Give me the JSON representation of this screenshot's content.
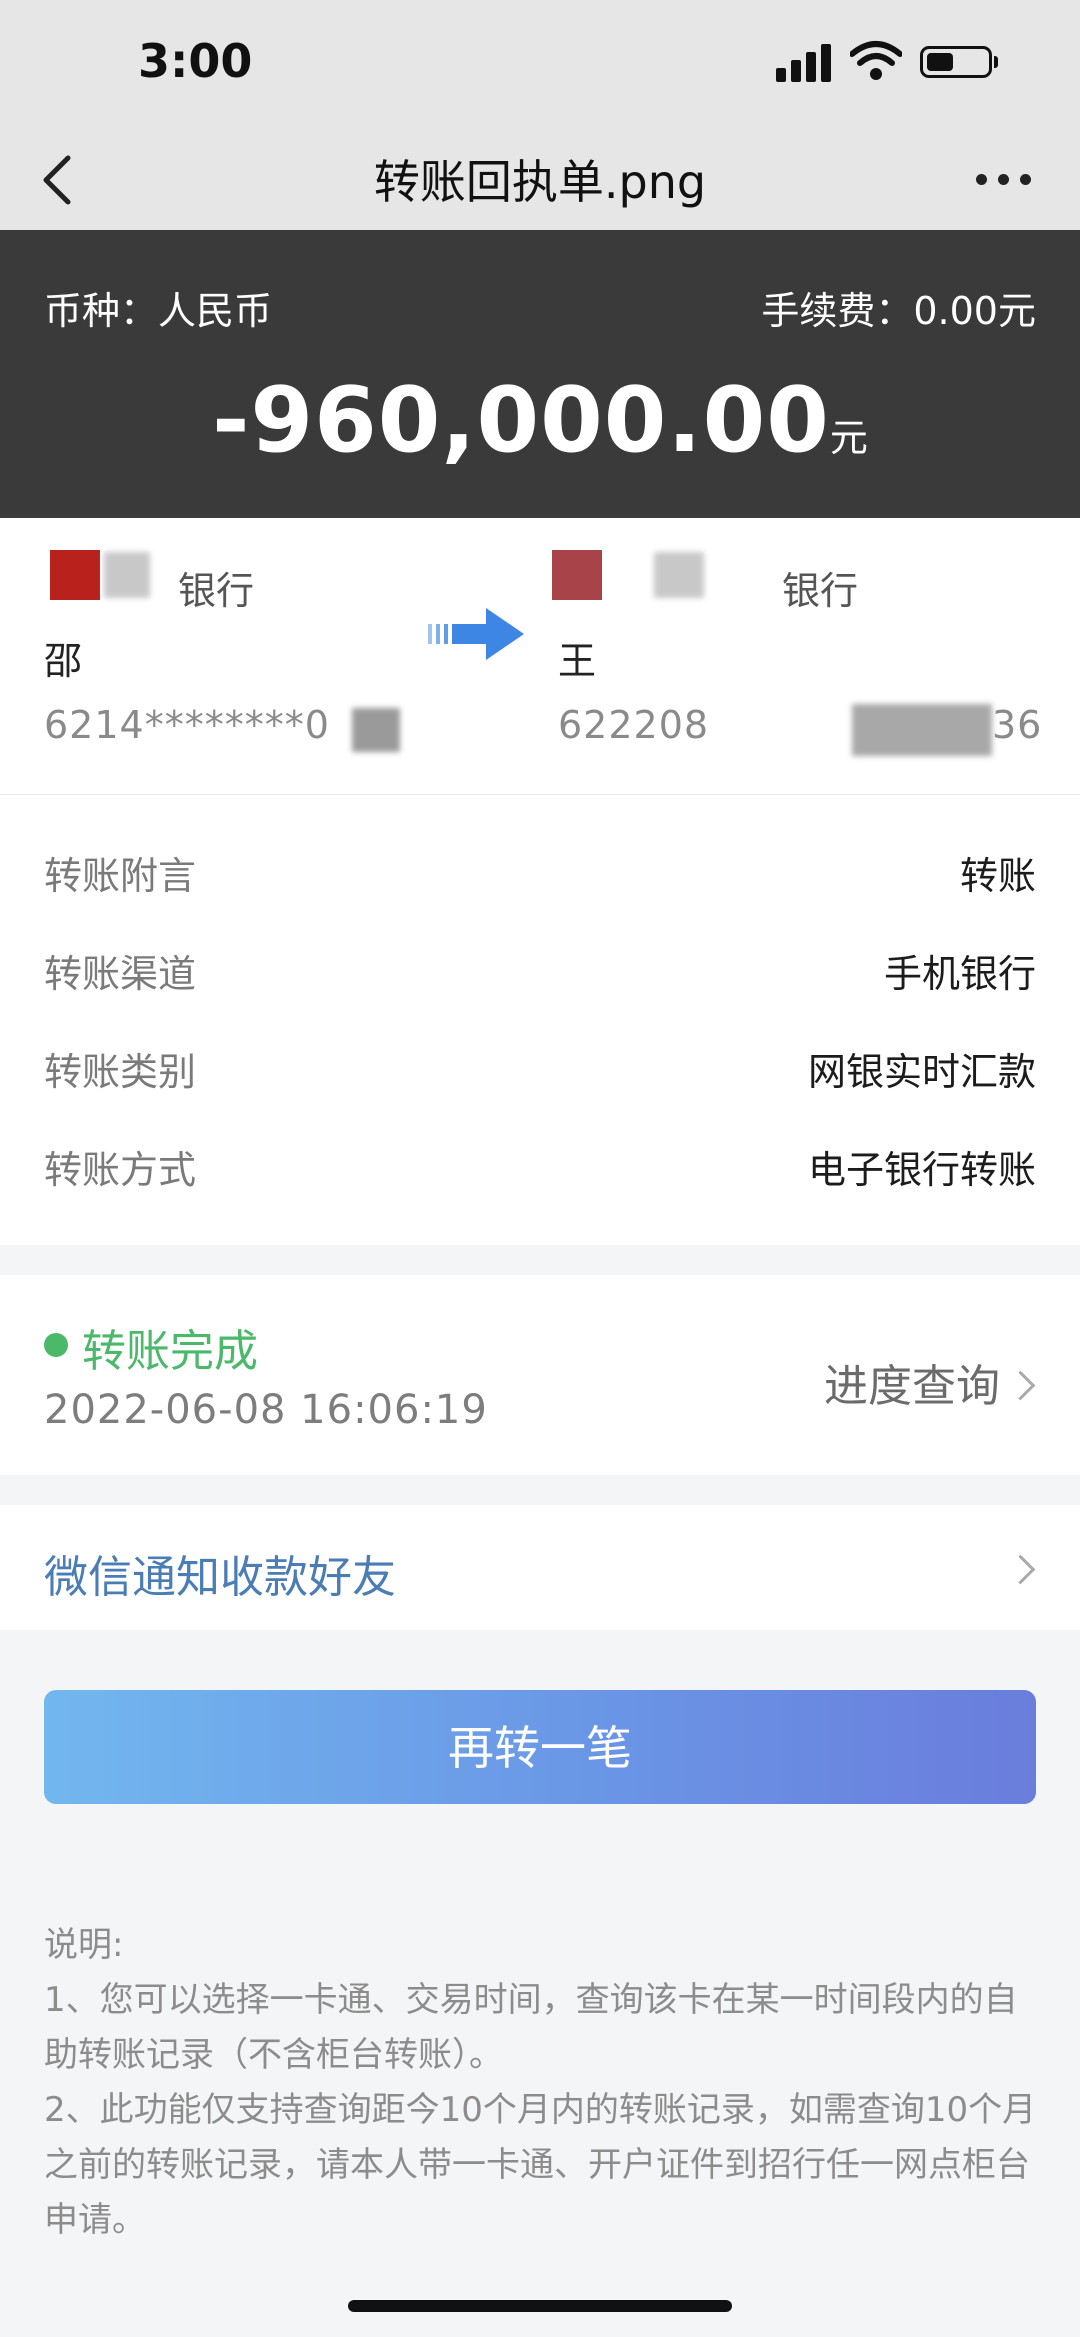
{
  "status_bar": {
    "time": "3:00"
  },
  "nav": {
    "title": "转账回执单.png"
  },
  "summary": {
    "currency": "币种：人民币",
    "fee": "手续费：0.00元",
    "amount": "-960,000.00",
    "amount_unit": "元"
  },
  "payer": {
    "bank": "银行",
    "name": "邵",
    "card": "6214********0"
  },
  "payee": {
    "bank": "银行",
    "name": "王",
    "card_prefix": "622208",
    "card_suffix": "36"
  },
  "details": [
    {
      "label": "转账附言",
      "value": "转账"
    },
    {
      "label": "转账渠道",
      "value": "手机银行"
    },
    {
      "label": "转账类别",
      "value": "网银实时汇款"
    },
    {
      "label": "转账方式",
      "value": "电子银行转账"
    }
  ],
  "transfer_status": {
    "text": "转账完成",
    "time": "2022-06-08 16:06:19",
    "progress_link": "进度查询",
    "color": "#4cb86a"
  },
  "wechat_notify": "微信通知收款好友",
  "again_button": "再转一笔",
  "notes": [
    "说明:",
    "1、您可以选择一卡通、交易时间，查询该卡在某一时间段内的自助转账记录（不含柜台转账）。",
    "2、此功能仅支持查询距今10个月内的转账记录，如需查询10个月之前的转账记录，请本人带一卡通、开户证件到招行任一网点柜台申请。"
  ],
  "colors": {
    "header_dark": "#3a3a3a",
    "link_blue": "#4a7cb5",
    "button_start": "#72b7ef",
    "button_end": "#6a7ddc"
  }
}
